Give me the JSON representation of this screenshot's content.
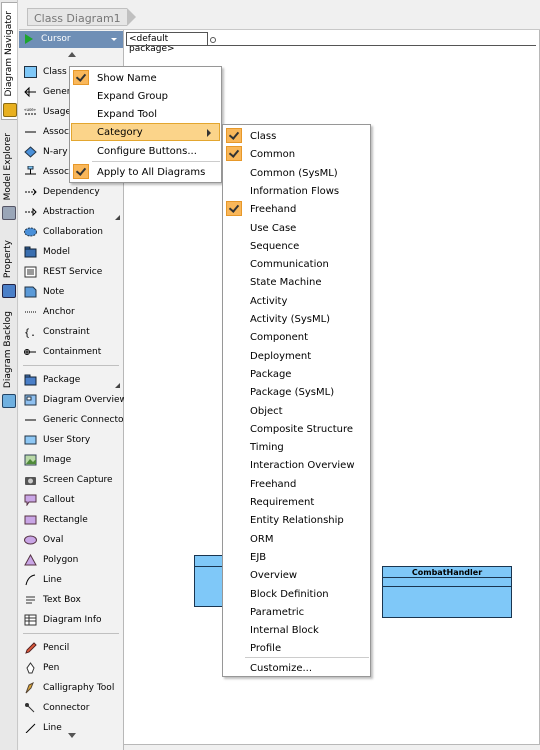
{
  "colors": {
    "accent": "#6f8fb6",
    "class_fill": "#7fc8f8",
    "menu_highlight": "#fbd48a",
    "check": "#f9b75a"
  },
  "vertical_tabs": [
    {
      "label": "Diagram Navigator",
      "icon": "diagram-navigator-icon"
    },
    {
      "label": "Model Explorer",
      "icon": "model-explorer-icon"
    },
    {
      "label": "Property",
      "icon": "property-icon"
    },
    {
      "label": "Diagram Backlog",
      "icon": "diagram-backlog-icon"
    }
  ],
  "tab": {
    "title": "Class Diagram1"
  },
  "canvas": {
    "package_label": "<default package>"
  },
  "classes": [
    {
      "name": ""
    },
    {
      "name": "CombatHandler"
    }
  ],
  "palette": {
    "cursor_label": "Cursor",
    "items": [
      {
        "label": "Class"
      },
      {
        "label": "Generalization"
      },
      {
        "label": "Usage"
      },
      {
        "label": "Association"
      },
      {
        "label": "N-ary"
      },
      {
        "label": "Association Class"
      },
      {
        "label": "Dependency"
      },
      {
        "label": "Abstraction"
      },
      {
        "label": "Collaboration"
      },
      {
        "label": "Model"
      },
      {
        "label": "REST Service"
      },
      {
        "label": "Note"
      },
      {
        "label": "Anchor"
      },
      {
        "label": "Constraint"
      },
      {
        "label": "Containment"
      },
      {
        "label": "Package"
      },
      {
        "label": "Diagram Overview"
      },
      {
        "label": "Generic Connector"
      },
      {
        "label": "User Story"
      },
      {
        "label": "Image"
      },
      {
        "label": "Screen Capture"
      },
      {
        "label": "Callout"
      },
      {
        "label": "Rectangle"
      },
      {
        "label": "Oval"
      },
      {
        "label": "Polygon"
      },
      {
        "label": "Line"
      },
      {
        "label": "Text Box"
      },
      {
        "label": "Diagram Info"
      },
      {
        "label": "Pencil"
      },
      {
        "label": "Pen"
      },
      {
        "label": "Calligraphy Tool"
      },
      {
        "label": "Connector"
      },
      {
        "label": "Line"
      }
    ]
  },
  "context_menu": {
    "items": [
      {
        "label": "Show Name",
        "checked": true
      },
      {
        "label": "Expand Group",
        "checked": false
      },
      {
        "label": "Expand Tool",
        "checked": false
      },
      {
        "label": "Category",
        "checked": false,
        "highlighted": true,
        "submenu": true
      },
      {
        "label": "Configure Buttons...",
        "checked": false
      },
      {
        "label": "Apply to All Diagrams",
        "checked": true
      }
    ]
  },
  "category_menu": {
    "items": [
      {
        "label": "Class",
        "checked": true
      },
      {
        "label": "Common",
        "checked": true
      },
      {
        "label": "Common (SysML)",
        "checked": false
      },
      {
        "label": "Information Flows",
        "checked": false
      },
      {
        "label": "Freehand",
        "checked": true
      },
      {
        "label": "Use Case",
        "checked": false
      },
      {
        "label": "Sequence",
        "checked": false
      },
      {
        "label": "Communication",
        "checked": false
      },
      {
        "label": "State Machine",
        "checked": false
      },
      {
        "label": "Activity",
        "checked": false
      },
      {
        "label": "Activity (SysML)",
        "checked": false
      },
      {
        "label": "Component",
        "checked": false
      },
      {
        "label": "Deployment",
        "checked": false
      },
      {
        "label": "Package",
        "checked": false
      },
      {
        "label": "Package (SysML)",
        "checked": false
      },
      {
        "label": "Object",
        "checked": false
      },
      {
        "label": "Composite Structure",
        "checked": false
      },
      {
        "label": "Timing",
        "checked": false
      },
      {
        "label": "Interaction Overview",
        "checked": false
      },
      {
        "label": "Freehand",
        "checked": false
      },
      {
        "label": "Requirement",
        "checked": false
      },
      {
        "label": "Entity Relationship",
        "checked": false
      },
      {
        "label": "ORM",
        "checked": false
      },
      {
        "label": "EJB",
        "checked": false
      },
      {
        "label": "Overview",
        "checked": false
      },
      {
        "label": "Block Definition",
        "checked": false
      },
      {
        "label": "Parametric",
        "checked": false
      },
      {
        "label": "Internal Block",
        "checked": false
      },
      {
        "label": "Profile",
        "checked": false
      }
    ],
    "customize_label": "Customize..."
  }
}
